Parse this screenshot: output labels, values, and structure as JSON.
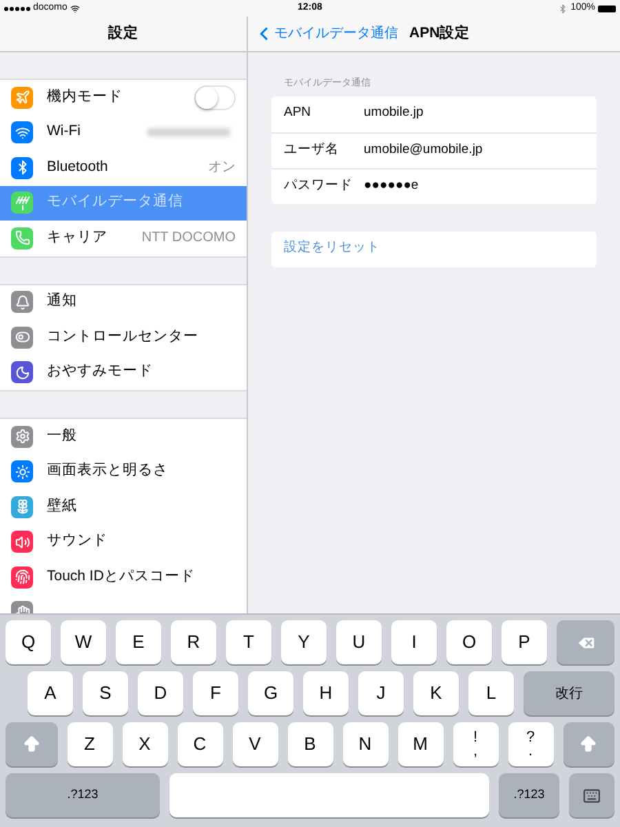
{
  "status_bar": {
    "carrier": "docomo",
    "time": "12:08",
    "battery": "100%"
  },
  "sidebar": {
    "title": "設定",
    "groups": [
      {
        "items": [
          {
            "label": "機内モード",
            "kind": "toggle",
            "on": false,
            "selected": false,
            "color": "#ff9500"
          },
          {
            "label": "Wi-Fi",
            "kind": "blurred",
            "selected": false,
            "color": "#007aff"
          },
          {
            "label": "Bluetooth",
            "kind": "value",
            "value": "オン",
            "selected": false,
            "color": "#007aff"
          },
          {
            "label": "モバイルデータ通信",
            "kind": "plain",
            "selected": true,
            "color": "#4cd964"
          },
          {
            "label": "キャリア",
            "kind": "value",
            "value": "NTT DOCOMO",
            "selected": false,
            "color": "#4cd964"
          }
        ]
      },
      {
        "items": [
          {
            "label": "通知",
            "kind": "plain",
            "selected": false,
            "color": "#8e8e93"
          },
          {
            "label": "コントロールセンター",
            "kind": "plain",
            "selected": false,
            "color": "#8e8e93"
          },
          {
            "label": "おやすみモード",
            "kind": "plain",
            "selected": false,
            "color": "#5856d6"
          }
        ]
      },
      {
        "items": [
          {
            "label": "一般",
            "kind": "plain",
            "selected": false,
            "color": "#8e8e93"
          },
          {
            "label": "画面表示と明るさ",
            "kind": "plain",
            "selected": false,
            "color": "#007aff"
          },
          {
            "label": "壁紙",
            "kind": "plain",
            "selected": false,
            "color": "#34aadc"
          },
          {
            "label": "サウンド",
            "kind": "plain",
            "selected": false,
            "color": "#ff2d55"
          },
          {
            "label": "Touch IDとパスコード",
            "kind": "plain",
            "selected": false,
            "color": "#ff2d55"
          },
          {
            "kind": "hidden",
            "selected": false,
            "color": "#8e8e93"
          }
        ]
      }
    ]
  },
  "detail": {
    "back": "モバイルデータ通信",
    "title": "APN設定",
    "section_header": "モバイルデータ通信",
    "fields": [
      {
        "label": "APN",
        "value": "umobile.jp"
      },
      {
        "label": "ユーザ名",
        "value": "umobile@umobile.jp"
      },
      {
        "label": "パスワード",
        "value": "●●●●●●e"
      }
    ],
    "reset": "設定をリセット"
  },
  "keyboard": {
    "rows": [
      {
        "keys": [
          {
            "kind": "letter",
            "label": "Q"
          },
          {
            "kind": "letter",
            "label": "W"
          },
          {
            "kind": "letter",
            "label": "E"
          },
          {
            "kind": "letter",
            "label": "R"
          },
          {
            "kind": "letter",
            "label": "T"
          },
          {
            "kind": "letter",
            "label": "Y"
          },
          {
            "kind": "letter",
            "label": "U"
          },
          {
            "kind": "letter",
            "label": "I"
          },
          {
            "kind": "letter",
            "label": "O"
          },
          {
            "kind": "letter",
            "label": "P"
          },
          {
            "kind": "delete"
          }
        ]
      },
      {
        "keys": [
          {
            "kind": "letter",
            "label": "A"
          },
          {
            "kind": "letter",
            "label": "S"
          },
          {
            "kind": "letter",
            "label": "D"
          },
          {
            "kind": "letter",
            "label": "F"
          },
          {
            "kind": "letter",
            "label": "G"
          },
          {
            "kind": "letter",
            "label": "H"
          },
          {
            "kind": "letter",
            "label": "J"
          },
          {
            "kind": "letter",
            "label": "K"
          },
          {
            "kind": "letter",
            "label": "L"
          },
          {
            "kind": "return",
            "label": "改行"
          }
        ]
      },
      {
        "keys": [
          {
            "kind": "shift"
          },
          {
            "kind": "letter",
            "label": "Z"
          },
          {
            "kind": "letter",
            "label": "X"
          },
          {
            "kind": "letter",
            "label": "C"
          },
          {
            "kind": "letter",
            "label": "V"
          },
          {
            "kind": "letter",
            "label": "B"
          },
          {
            "kind": "letter",
            "label": "N"
          },
          {
            "kind": "letter",
            "label": "M"
          },
          {
            "kind": "punct",
            "label": "!",
            "sub": ","
          },
          {
            "kind": "punct",
            "label": "?",
            "sub": "."
          },
          {
            "kind": "shift"
          }
        ]
      },
      {
        "keys": [
          {
            "kind": "numbers",
            "label": ".?123"
          },
          {
            "kind": "space"
          },
          {
            "kind": "numbers",
            "label": ".?123"
          },
          {
            "kind": "dismiss"
          }
        ]
      }
    ]
  }
}
